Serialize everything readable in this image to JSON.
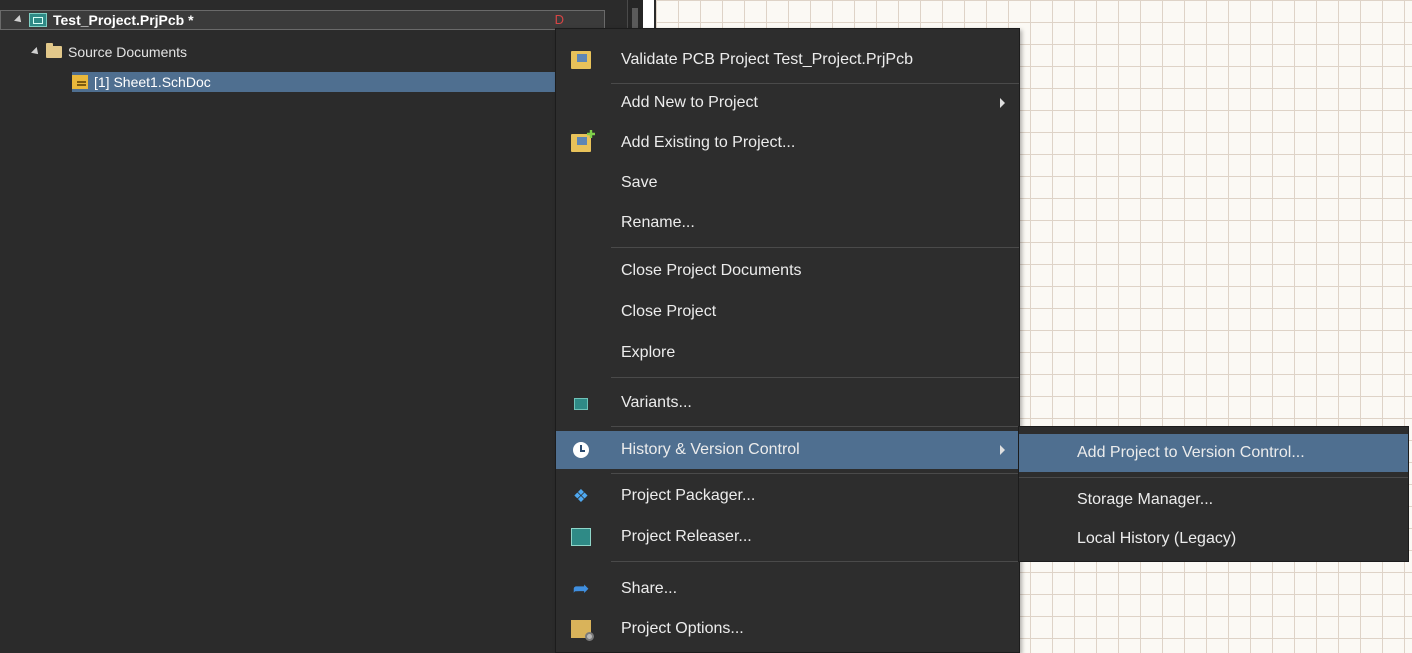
{
  "tree": {
    "project": "Test_Project.PrjPcb *",
    "modified_marker": "D",
    "folder": "Source Documents",
    "document": "[1] Sheet1.SchDoc"
  },
  "menu": {
    "items": [
      {
        "label": "Validate PCB Project Test_Project.PrjPcb",
        "icon": "validate-icon"
      },
      {
        "label": "Add New to Project",
        "submenu": true
      },
      {
        "label": "Add Existing to Project...",
        "icon": "add-existing-icon"
      },
      {
        "label": "Save"
      },
      {
        "label": "Rename..."
      },
      {
        "label": "Close Project Documents"
      },
      {
        "label": "Close Project"
      },
      {
        "label": "Explore"
      },
      {
        "label": "Variants...",
        "icon": "variants-icon"
      },
      {
        "label": "History & Version Control",
        "icon": "clock-icon",
        "submenu": true,
        "highlighted": true
      },
      {
        "label": "Project Packager...",
        "icon": "dropbox-icon"
      },
      {
        "label": "Project Releaser...",
        "icon": "releaser-icon"
      },
      {
        "label": "Share...",
        "icon": "share-icon"
      },
      {
        "label": "Project Options...",
        "icon": "project-options-icon"
      }
    ]
  },
  "submenu": {
    "items": [
      {
        "label": "Add Project to Version Control...",
        "highlighted": true
      },
      {
        "label": "Storage Manager..."
      },
      {
        "label": "Local History (Legacy)"
      }
    ]
  },
  "colors": {
    "panel_bg": "#2b2b2b",
    "menu_bg": "#2d2d2d",
    "highlight": "#4f6f90",
    "grid_line": "#ded3c7",
    "canvas_bg": "#fbf9f4"
  }
}
